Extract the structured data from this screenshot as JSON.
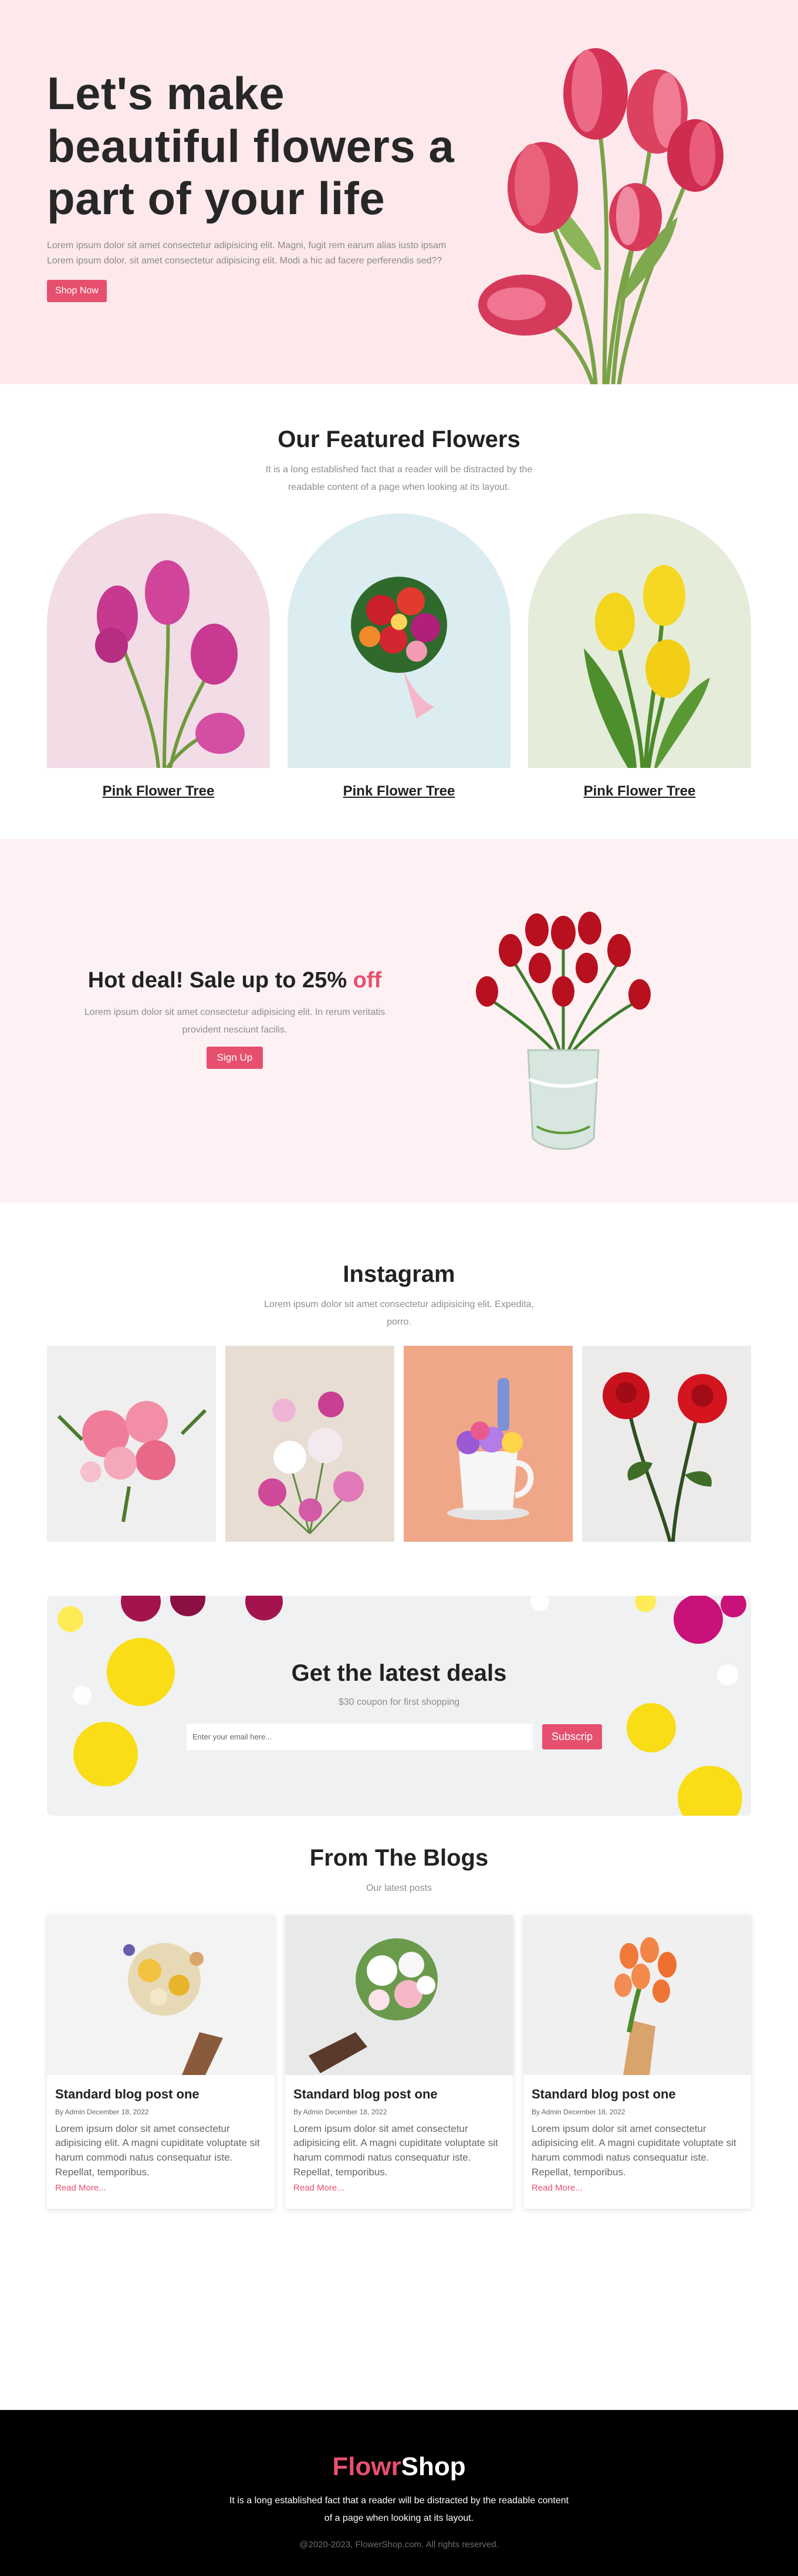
{
  "hero": {
    "title": "Let's make beautiful flowers a part of your life",
    "description": "Lorem ipsum dolor sit amet consectetur adipisicing elit. Magni, fugit rem earum alias iusto ipsam Lorem ipsum dolor, sit amet consectetur adipisicing elit. Modi a hic ad facere perferendis sed??",
    "button": "Shop Now"
  },
  "featured": {
    "title": "Our Featured Flowers",
    "subtitle": "It is a long established fact that a reader will be distracted by the readable content of a page when looking at its layout.",
    "cards": [
      {
        "label": "Pink Flower Tree",
        "bg": "#f2dce6"
      },
      {
        "label": "Pink Flower Tree",
        "bg": "#dcedf1"
      },
      {
        "label": "Pink Flower Tree",
        "bg": "#e5ecda"
      }
    ]
  },
  "deal": {
    "title_main": "Hot deal! Sale up to 25%",
    "title_accent": "off",
    "description": "Lorem ipsum dolor sit amet consectetur adipisicing elit. In rerum veritatis provident nesciunt facilis.",
    "button": "Sign Up"
  },
  "instagram": {
    "title": "Instagram",
    "subtitle": "Lorem ipsum dolor sit amet consectetur adipisicing elit. Expedita, porro."
  },
  "newsletter": {
    "title": "Get the latest deals",
    "subtitle": "$30 coupon for first shopping",
    "placeholder": "Enter your email here...",
    "button": "Subscrip"
  },
  "blogs": {
    "title": "From The Blogs",
    "subtitle": "Our latest posts",
    "posts": [
      {
        "title": "Standard blog post one",
        "meta": "By Admin December 18, 2022",
        "text": "Lorem ipsum dolor sit amet consectetur adipisicing elit. A magni cupiditate voluptate sit harum commodi natus consequatur iste. Repellat, temporibus.",
        "link": "Read More..."
      },
      {
        "title": "Standard blog post one",
        "meta": "By Admin December 18, 2022",
        "text": "Lorem ipsum dolor sit amet consectetur adipisicing elit. A magni cupiditate voluptate sit harum commodi natus consequatur iste. Repellat, temporibus.",
        "link": "Read More..."
      },
      {
        "title": "Standard blog post one",
        "meta": "By Admin December 18, 2022",
        "text": "Lorem ipsum dolor sit amet consectetur adipisicing elit. A magni cupiditate voluptate sit harum commodi natus consequatur iste. Repellat, temporibus.",
        "link": "Read More..."
      }
    ]
  },
  "footer": {
    "logo_part1": "Flowr",
    "logo_part2": "Shop",
    "text": "It is a long established fact that a reader will be distracted by the readable content of a page when looking at its layout.",
    "copyright": "@2020-2023, FlowerShop.com. All rights reserved."
  },
  "colors": {
    "accent": "#e6506e",
    "hero_bg": "#fde9ec",
    "deal_bg": "#fdf1f4",
    "footer_bg": "#000000"
  }
}
